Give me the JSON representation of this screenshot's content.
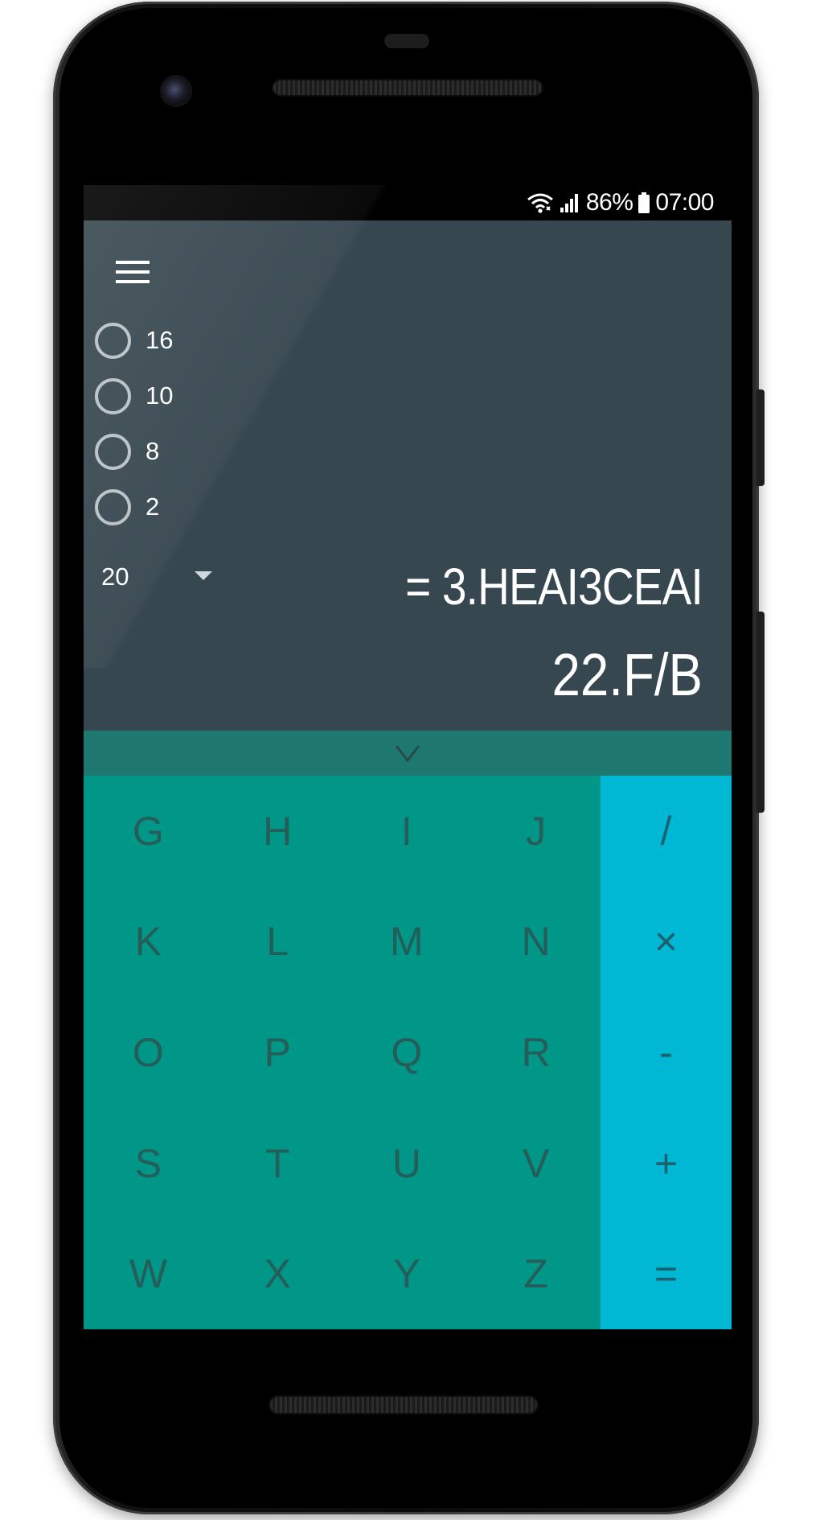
{
  "status_bar": {
    "battery": "86%",
    "time": "07:00",
    "wifi_icon": "wifi-icon",
    "signal_icon": "signal-icon",
    "battery_icon": "battery-icon"
  },
  "toolbar": {
    "menu_icon": "menu-icon"
  },
  "radix_options": [
    {
      "label": "16",
      "selected": false
    },
    {
      "label": "10",
      "selected": false
    },
    {
      "label": "8",
      "selected": false
    },
    {
      "label": "2",
      "selected": false
    }
  ],
  "precision": {
    "value": "20"
  },
  "display": {
    "result": "= 3.HEAI3CEAI",
    "input": "22.F/B"
  },
  "collapse": {
    "icon": "chevron-down-icon"
  },
  "keypad": {
    "rows": [
      {
        "letters": [
          "G",
          "H",
          "I",
          "J"
        ],
        "op": "/"
      },
      {
        "letters": [
          "K",
          "L",
          "M",
          "N"
        ],
        "op": "×"
      },
      {
        "letters": [
          "O",
          "P",
          "Q",
          "R"
        ],
        "op": "-"
      },
      {
        "letters": [
          "S",
          "T",
          "U",
          "V"
        ],
        "op": "+"
      },
      {
        "letters": [
          "W",
          "X",
          "Y",
          "Z"
        ],
        "op": "="
      }
    ]
  },
  "colors": {
    "display_bg": "#37474f",
    "collapse_bar": "#1e7870",
    "letters_bg": "#009688",
    "ops_bg": "#00b8d4"
  }
}
